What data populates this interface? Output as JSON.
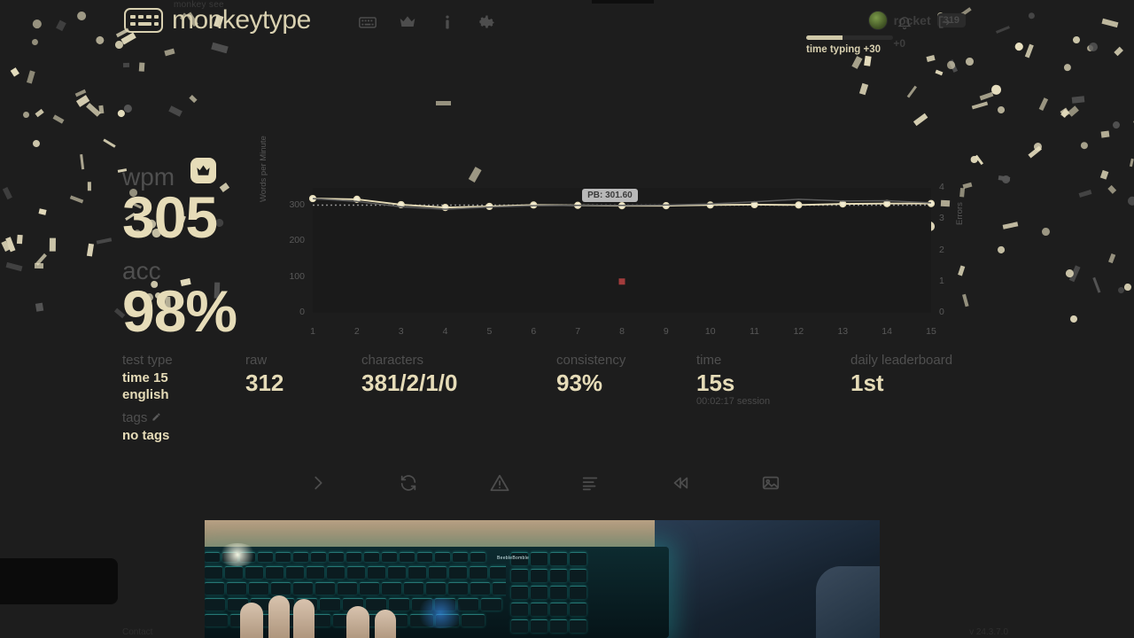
{
  "header": {
    "logo_tagline": "monkey see",
    "logo_text": "monkeytype",
    "logo_icon": "keyboard-logo-icon",
    "nav": [
      {
        "name": "keyboard-icon",
        "label": "keyboard"
      },
      {
        "name": "crown-icon",
        "label": "leaderboards"
      },
      {
        "name": "info-icon",
        "label": "about"
      },
      {
        "name": "gear-icon",
        "label": "settings"
      }
    ],
    "account": {
      "avatar": "user-avatar",
      "username": "rocket",
      "level": "319",
      "bell_icon": "notification-bell-icon",
      "logout_icon": "sign-out-icon",
      "xp_label": "time typing +30",
      "xp_gain": "+0",
      "xp_percent": 42
    }
  },
  "results": {
    "wpm_label": "wpm",
    "wpm_value": "305",
    "crown_icon": "crown-badge-icon",
    "acc_label": "acc",
    "acc_value": "98%"
  },
  "stats": [
    {
      "label": "test type",
      "value": "time 15",
      "value2": "english",
      "small": true
    },
    {
      "label": "tags",
      "value": "no tags",
      "small": true,
      "icon": "pencil-edit-icon"
    },
    {
      "label": "raw",
      "value": "312"
    },
    {
      "label": "characters",
      "value": "381/2/1/0"
    },
    {
      "label": "consistency",
      "value": "93%"
    },
    {
      "label": "time",
      "value": "15s",
      "sub": "00:02:17 session"
    },
    {
      "label": "daily leaderboard",
      "value": "1st"
    }
  ],
  "actions": [
    {
      "name": "next-test-button",
      "icon": "chevron-right-icon",
      "label": "next test"
    },
    {
      "name": "repeat-test-button",
      "icon": "refresh-icon",
      "label": "repeat test"
    },
    {
      "name": "report-quote-button",
      "icon": "warning-triangle-icon",
      "label": "report quote"
    },
    {
      "name": "practice-words-button",
      "icon": "list-lines-icon",
      "label": "practice words"
    },
    {
      "name": "restart-test-button",
      "icon": "rewind-icon",
      "label": "restart test"
    },
    {
      "name": "save-screenshot-button",
      "icon": "image-icon",
      "label": "save screenshot"
    }
  ],
  "webcam": {
    "keyboard_brand": "BeebleBomble"
  },
  "footer": {
    "left": "Contact",
    "right": "v 24.3.7.0"
  },
  "colors": {
    "accent": "#e6dcb8",
    "background": "#1d1d1d",
    "plot_background": "#1a1a1a",
    "sub": "#4f4f4f",
    "error": "#a33c3c",
    "raw_line": "#5c5c5c",
    "pb_tooltip_bg": "#b9b9b9"
  },
  "chart_data": {
    "type": "line",
    "title": "",
    "xlabel": "",
    "ylabel": "Words per Minute",
    "ylabel_right": "Errors",
    "x": [
      1,
      2,
      3,
      4,
      5,
      6,
      7,
      8,
      9,
      10,
      11,
      12,
      13,
      14,
      15
    ],
    "xlim": [
      1,
      15
    ],
    "ylim": [
      0,
      350
    ],
    "ylim_right": [
      0,
      4
    ],
    "yticks": [
      0,
      100,
      200,
      300
    ],
    "yticks_right": [
      0,
      1,
      2,
      3,
      4
    ],
    "grid": false,
    "legend": "none",
    "series": [
      {
        "name": "wpm",
        "color": "#e6dcb8",
        "markers": true,
        "values": [
          320,
          318,
          303,
          295,
          298,
          302,
          301,
          300,
          300,
          302,
          303,
          302,
          305,
          306,
          306
        ]
      },
      {
        "name": "raw",
        "color": "#5c5c5c",
        "markers": false,
        "values": [
          320,
          312,
          297,
          290,
          296,
          300,
          301,
          301,
          302,
          305,
          311,
          318,
          313,
          314,
          308
        ]
      },
      {
        "name": "errors",
        "color": "#a33c3c",
        "axis": "right",
        "points": [
          {
            "x": 8,
            "y": 1
          }
        ]
      }
    ],
    "annotations": [
      {
        "type": "hline",
        "label": "PB: 301.60",
        "value": 301.6,
        "style": "dotted"
      }
    ]
  }
}
